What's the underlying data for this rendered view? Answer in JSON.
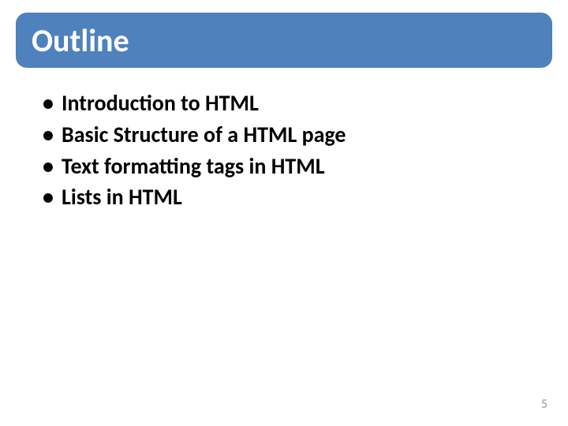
{
  "slide": {
    "title": "Outline",
    "bullets": [
      "Introduction to HTML",
      "Basic Structure of a HTML page",
      "Text formatting tags in HTML",
      "Lists in HTML"
    ],
    "page_number": "5"
  }
}
